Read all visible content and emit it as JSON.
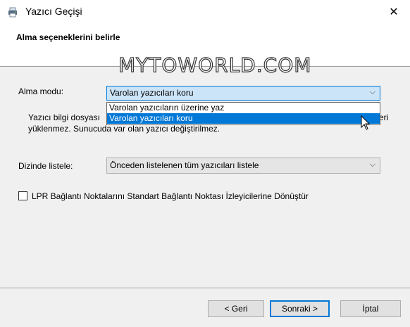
{
  "window": {
    "title": "Yazıcı Geçişi",
    "close_glyph": "✕"
  },
  "header": {
    "title": "Alma seçeneklerini belirle"
  },
  "watermark": "MYTOWORLD.COM",
  "import_mode": {
    "label": "Alma modu:",
    "selected": "Varolan yazıcıları koru",
    "options": [
      "Varolan yazıcıların üzerine yaz",
      "Varolan yazıcıları koru"
    ],
    "highlighted_index": 1,
    "chevron": "⌵"
  },
  "description": {
    "line1_start": "Yazıcı bilgi dosyası",
    "line1_end": "eri",
    "line2": "yüklenmez. Sunucuda var olan yazıcı değiştirilmez."
  },
  "list_in_directory": {
    "label": "Dizinde listele:",
    "selected": "Önceden listelenen tüm yazıcıları listele",
    "chevron": "⌵"
  },
  "lpr_checkbox": {
    "label": "LPR Bağlantı Noktalarını Standart Bağlantı Noktası İzleyicilerine Dönüştür",
    "checked": false
  },
  "buttons": {
    "back": "< Geri",
    "next": "Sonraki >",
    "cancel": "İptal"
  },
  "colors": {
    "accent": "#0078d7",
    "window_bg": "#f0f0f0",
    "header_bg": "#ffffff"
  }
}
